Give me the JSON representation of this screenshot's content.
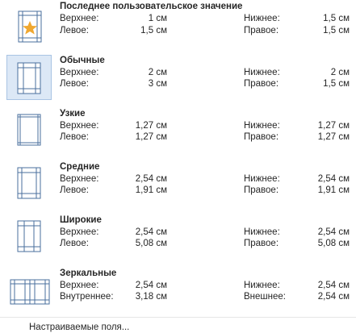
{
  "presets": [
    {
      "name": "Последнее пользовательское значение",
      "icon": "custom-margins-star-icon",
      "labels": [
        "Верхнее:",
        "Левое:",
        "Нижнее:",
        "Правое:"
      ],
      "values": [
        "1 см",
        "1,5 см",
        "1,5 см",
        "1,5 см"
      ]
    },
    {
      "name": "Обычные",
      "icon": "normal-margins-icon",
      "labels": [
        "Верхнее:",
        "Левое:",
        "Нижнее:",
        "Правое:"
      ],
      "values": [
        "2 см",
        "3 см",
        "2 см",
        "1,5 см"
      ]
    },
    {
      "name": "Узкие",
      "icon": "narrow-margins-icon",
      "labels": [
        "Верхнее:",
        "Левое:",
        "Нижнее:",
        "Правое:"
      ],
      "values": [
        "1,27 см",
        "1,27 см",
        "1,27 см",
        "1,27 см"
      ]
    },
    {
      "name": "Средние",
      "icon": "moderate-margins-icon",
      "labels": [
        "Верхнее:",
        "Левое:",
        "Нижнее:",
        "Правое:"
      ],
      "values": [
        "2,54 см",
        "1,91 см",
        "2,54 см",
        "1,91 см"
      ]
    },
    {
      "name": "Широкие",
      "icon": "wide-margins-icon",
      "labels": [
        "Верхнее:",
        "Левое:",
        "Нижнее:",
        "Правое:"
      ],
      "values": [
        "2,54 см",
        "5,08 см",
        "2,54 см",
        "5,08 см"
      ]
    },
    {
      "name": "Зеркальные",
      "icon": "mirrored-margins-icon",
      "labels": [
        "Верхнее:",
        "Внутреннее:",
        "Нижнее:",
        "Внешнее:"
      ],
      "values": [
        "2,54 см",
        "3,18 см",
        "2,54 см",
        "2,54 см"
      ]
    }
  ],
  "footer": {
    "custom_margins_label": "Настраиваемые поля..."
  },
  "colors": {
    "selected_bg": "#dce8f6",
    "icon_stroke": "#4a6f9e",
    "star": "#f0a830"
  }
}
